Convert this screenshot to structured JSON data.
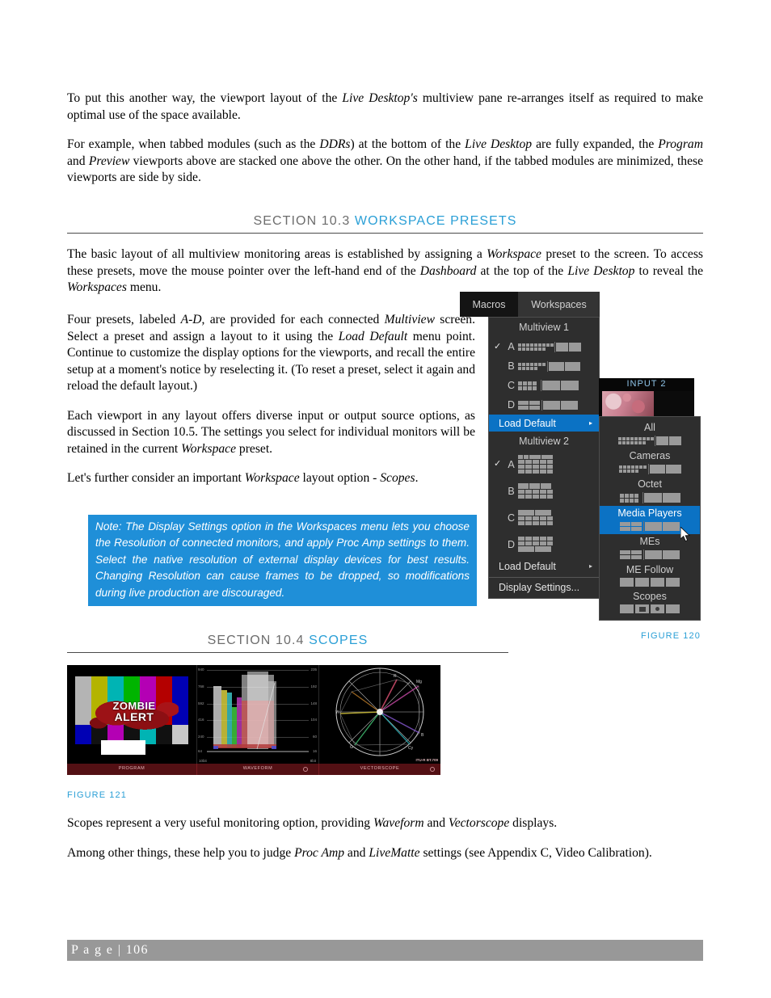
{
  "document": {
    "paragraphs": {
      "p1_a": "To put this another way, the viewport layout of the ",
      "p1_i1": "Live Desktop's",
      "p1_b": " multiview pane re-arranges itself as required to make optimal use of the space available.",
      "p2_a": "For example, when tabbed modules (such as the ",
      "p2_i1": "DDRs",
      "p2_b": ") at the bottom of the ",
      "p2_i2": "Live Desktop",
      "p2_c": " are fully expanded, the ",
      "p2_i3": "Program",
      "p2_d": " and ",
      "p2_i4": "Preview",
      "p2_e": " viewports above are stacked one above the other.  On the other hand, if the tabbed modules are minimized, these viewports are side by side.",
      "p3_a": "The basic layout of all multiview monitoring areas is established by assigning a ",
      "p3_i1": "Workspace",
      "p3_b": " preset to the screen.  To access these presets, move the mouse pointer over the left-hand end of the ",
      "p3_i2": "Dashboard",
      "p3_c": " at the top of the ",
      "p3_i3": "Live Desktop",
      "p3_d": " to reveal the ",
      "p3_i4": "Workspaces",
      "p3_e": " menu.",
      "p4_a": "Four presets, labeled ",
      "p4_i1": "A-D",
      "p4_b": ", are provided for each connected ",
      "p4_i2": "Multiview",
      "p4_c": " screen.  Select a preset and assign a layout to it using the ",
      "p4_i3": "Load Default",
      "p4_d": " menu point.  Continue to customize the display options for the viewports, and recall the entire setup at a moment's notice by reselecting it.  (To reset a preset, select it again and reload the default layout.)",
      "p5_a": "Each viewport in any layout offers diverse input or output source options, as discussed in Section 10.5. The settings you select for individual monitors will be retained in the current ",
      "p5_i1": "Workspace",
      "p5_b": " preset.",
      "p6_a": "Let's further consider an important ",
      "p6_i1": "Workspace",
      "p6_b": " layout option - ",
      "p6_i2": "Scopes",
      "p6_c": ".",
      "p7_a": "Scopes represent a very useful monitoring option, providing ",
      "p7_i1": "Waveform",
      "p7_b": " and ",
      "p7_i2": "Vectorscope",
      "p7_c": " displays.",
      "p8_a": "Among other things, these help you to judge ",
      "p8_i1": "Proc Amp",
      "p8_b": " and ",
      "p8_i2": "LiveMatte",
      "p8_c": " settings (see Appendix C, Video Calibration)."
    },
    "sections": [
      {
        "number": "SECTION 10.3",
        "name": "WORKSPACE PRESETS"
      },
      {
        "number": "SECTION 10.4",
        "name": "SCOPES"
      }
    ],
    "note": "Note: The Display Settings option in the Workspaces menu lets you choose the Resolution of connected monitors, and apply Proc Amp settings to them. Select the native resolution of external display devices for best results. Changing Resolution can cause frames to be dropped, so modifications during live production are discouraged.",
    "figures": {
      "fig120": "FIGURE 120",
      "fig121": "FIGURE 121"
    },
    "footer": {
      "page_label": "P a g e  |  106"
    },
    "colors": {
      "accent_blue": "#2a9fd6",
      "note_blue": "#1f8fd8",
      "selection_blue": "#0b72c4",
      "heading_gray": "#6d6d6d",
      "footer_gray": "#989898"
    }
  },
  "workspaces_menu": {
    "tabs": [
      {
        "label": "Macros",
        "active": false
      },
      {
        "label": "Workspaces",
        "active": true
      }
    ],
    "groups": [
      {
        "header": "Multiview 1",
        "presets": [
          {
            "letter": "A",
            "checked": true
          },
          {
            "letter": "B",
            "checked": false
          },
          {
            "letter": "C",
            "checked": false
          },
          {
            "letter": "D",
            "checked": false
          }
        ],
        "load_default": {
          "label": "Load Default",
          "arrow": "▸",
          "highlighted": true
        }
      },
      {
        "header": "Multiview 2",
        "presets": [
          {
            "letter": "A",
            "checked": true
          },
          {
            "letter": "B",
            "checked": false
          },
          {
            "letter": "C",
            "checked": false
          },
          {
            "letter": "D",
            "checked": false
          }
        ],
        "load_default": {
          "label": "Load Default",
          "arrow": "▸",
          "highlighted": false
        }
      }
    ],
    "display_settings": "Display Settings...",
    "check_glyph": "✓"
  },
  "load_default_submenu": {
    "items": [
      {
        "label": "All",
        "selected": false
      },
      {
        "label": "Cameras",
        "selected": false
      },
      {
        "label": "Octet",
        "selected": false
      },
      {
        "label": "Media Players",
        "selected": true
      },
      {
        "label": "MEs",
        "selected": false
      },
      {
        "label": "ME Follow",
        "selected": false
      },
      {
        "label": "Scopes",
        "selected": false
      }
    ]
  },
  "input_thumbnail": {
    "label": "INPUT 2"
  },
  "scopes_figure": {
    "panels": [
      {
        "label": "PROGRAM",
        "has_dot": false
      },
      {
        "label": "WAVEFORM",
        "has_dot": true
      },
      {
        "label": "VECTORSCOPE",
        "has_dot": true
      }
    ],
    "program_overlay": {
      "line1": "ZOMBIE",
      "line2": "ALERT"
    },
    "waveform": {
      "left_ticks": [
        "940",
        "768",
        "592",
        "416",
        "240",
        "64"
      ],
      "right_ticks": [
        "235",
        "192",
        "148",
        "104",
        "60",
        "16"
      ],
      "corner_left": "10bit",
      "corner_right": "8bit"
    },
    "vectorscope": {
      "standard": "ITU-R BT.709",
      "targets": [
        "R",
        "Mg",
        "B",
        "Cy",
        "G",
        "Yl"
      ]
    }
  }
}
